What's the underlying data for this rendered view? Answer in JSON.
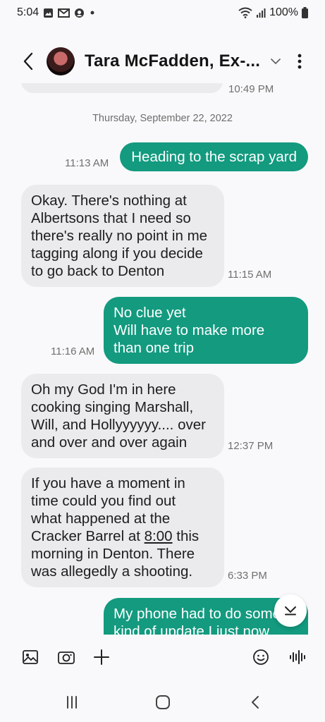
{
  "status_bar": {
    "time": "5:04",
    "battery": "100%",
    "icons": [
      "image-icon",
      "gmail-icon",
      "messenger-icon",
      "dot-icon",
      "wifi-icon",
      "signal-icon",
      "battery-icon"
    ]
  },
  "header": {
    "contact_name": "Tara McFadden, Ex-...",
    "icons": {
      "back": "back-arrow-icon",
      "expand": "chevron-down-icon",
      "more": "more-vertical-icon"
    }
  },
  "conversation": {
    "partial_timestamp": "10:49 PM",
    "date_separator": "Thursday, September 22, 2022",
    "messages": [
      {
        "direction": "outgoing",
        "text": "Heading to the scrap yard",
        "time": "11:13 AM"
      },
      {
        "direction": "incoming",
        "text": "Okay. There's nothing at\nAlbertsons that I need so\nthere's really no point in me\ntagging along if you decide\nto go back to Denton",
        "time": "11:15 AM"
      },
      {
        "direction": "outgoing",
        "text": "No clue yet\nWill have to make more\nthan one trip",
        "time": "11:16 AM"
      },
      {
        "direction": "incoming",
        "text": "Oh my God I'm in here\ncooking singing Marshall,\nWill, and Hollyyyyyy.... over\nand over and over again",
        "time": "12:37 PM"
      },
      {
        "direction": "incoming",
        "text_before_link": "If you have a moment in\ntime could you find out\nwhat happened at the\nCracker Barrel at ",
        "link_text": "8:00",
        "text_after_link": " this\nmorning in Denton. There\nwas allegedly a shooting.",
        "time": "6:33 PM"
      },
      {
        "direction": "outgoing",
        "text": "My phone had to do some\nkind of update I just now\ngot all my messages. I'll\nall... let you know\nup when I get a chance",
        "time": ""
      }
    ]
  },
  "input_bar": {
    "icons": [
      "gallery-icon",
      "camera-icon",
      "add-icon",
      "emoji-icon",
      "voice-icon"
    ]
  },
  "nav_bar": {
    "icons": [
      "recent-apps-icon",
      "home-icon",
      "back-nav-icon"
    ]
  },
  "colors": {
    "outgoing_bubble": "#139a7f",
    "incoming_bubble": "#ebebee",
    "background": "#f9f9fb"
  }
}
